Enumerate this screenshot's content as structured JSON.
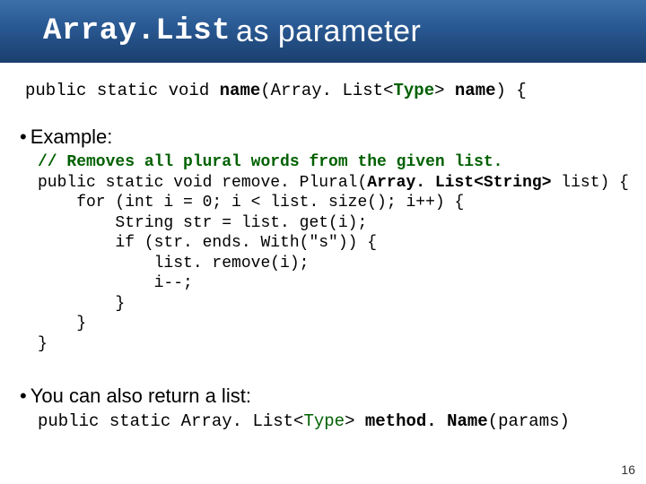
{
  "title": {
    "mono": "Array.List",
    "rest": "as parameter"
  },
  "signature": {
    "prefix": "public static void ",
    "name1": "name",
    "open": "(Array. List<",
    "type": "Type",
    "close": "> ",
    "name2": "name",
    "end": ") {"
  },
  "bullets": {
    "example": "Example:",
    "returnlist": "You can also return a list:"
  },
  "code": {
    "comment": "// Removes all plural words from the given list.",
    "l1a": "public static void remove. Plural(",
    "l1b": "Array. List<String>",
    "l1c": " list) {",
    "l2": "    for (int i = 0; i < list. size(); i++) {",
    "l3": "        String str = list. get(i);",
    "l4": "        if (str. ends. With(\"s\")) {",
    "l5": "            list. remove(i);",
    "l6": "            i--;",
    "l7": "        }",
    "l8": "    }",
    "l9": "}"
  },
  "retline": {
    "prefix": "public static Array. List<",
    "type": "Type",
    "mid": "> ",
    "method": "method. Name",
    "params": "(params)"
  },
  "page": "16"
}
